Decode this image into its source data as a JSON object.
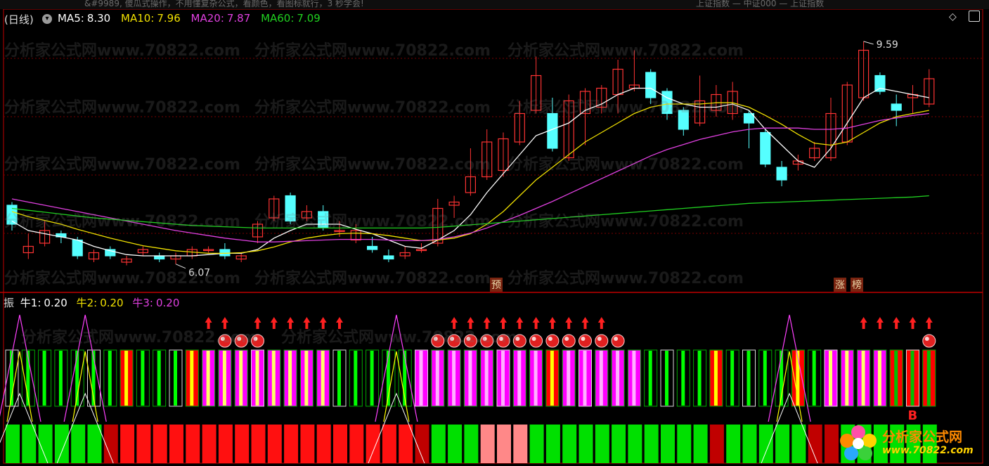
{
  "top_strip": {
    "left_text": "&#9989, 傻瓜式操作，不用懂复杂公式，看颜色，看图标就行，3 秒学会!",
    "right_text": "上证指数 — 中证000 — 上证指数"
  },
  "main_header": {
    "period": "(日线)",
    "ma5_label": "MA5:",
    "ma5_value": "8.30",
    "ma10_label": "MA10:",
    "ma10_value": "7.96",
    "ma20_label": "MA20:",
    "ma20_value": "7.87",
    "ma60_label": "MA60:",
    "ma60_value": "7.09"
  },
  "colors": {
    "ma5": "#ffffff",
    "ma10": "#f0e000",
    "ma20": "#e040e0",
    "ma60": "#20d020",
    "up": "#ff3333",
    "down": "#55ffff",
    "panel_border": "#c00000"
  },
  "price_labels": {
    "high": "9.59",
    "low": "6.07"
  },
  "tags": {
    "yu": "预",
    "zhang": "涨",
    "bang": "榜"
  },
  "watermark": "分析家公式网www.70822.com",
  "sub_header": {
    "title": "振",
    "niu1_label": "牛1:",
    "niu1_value": "0.20",
    "niu2_label": "牛2:",
    "niu2_value": "0.20",
    "niu3_label": "牛3:",
    "niu3_value": "0.20"
  },
  "buy_marker": "B",
  "logo": {
    "name": "分析家公式网",
    "url": "www.70822.com"
  },
  "corner_icons": [
    "diamond-icon",
    "window-restore-icon"
  ],
  "chart_data": {
    "type": "candlestick",
    "title": "",
    "ylim": [
      5.8,
      9.8
    ],
    "candles": [
      [
        7.0,
        6.7,
        7.05,
        6.6
      ],
      [
        6.25,
        6.35,
        6.55,
        6.15
      ],
      [
        6.4,
        6.6,
        6.75,
        6.35
      ],
      [
        6.55,
        6.5,
        6.6,
        6.4
      ],
      [
        6.45,
        6.2,
        6.5,
        6.15
      ],
      [
        6.15,
        6.25,
        6.3,
        6.1
      ],
      [
        6.3,
        6.2,
        6.35,
        6.15
      ],
      [
        6.1,
        6.15,
        6.2,
        6.05
      ],
      [
        6.25,
        6.3,
        6.35,
        6.2
      ],
      [
        6.2,
        6.15,
        6.25,
        6.1
      ],
      [
        6.15,
        6.2,
        6.25,
        6.07
      ],
      [
        6.2,
        6.3,
        6.35,
        6.15
      ],
      [
        6.3,
        6.3,
        6.35,
        6.25
      ],
      [
        6.3,
        6.2,
        6.4,
        6.15
      ],
      [
        6.15,
        6.2,
        6.25,
        6.1
      ],
      [
        6.5,
        6.7,
        6.75,
        6.4
      ],
      [
        6.8,
        7.1,
        7.15,
        6.75
      ],
      [
        7.15,
        6.75,
        7.2,
        6.7
      ],
      [
        6.8,
        6.9,
        7.0,
        6.75
      ],
      [
        6.9,
        6.65,
        7.0,
        6.6
      ],
      [
        6.6,
        6.6,
        6.75,
        6.5
      ],
      [
        6.45,
        6.6,
        6.7,
        6.4
      ],
      [
        6.35,
        6.3,
        6.5,
        6.25
      ],
      [
        6.2,
        6.15,
        6.3,
        6.1
      ],
      [
        6.2,
        6.25,
        6.35,
        6.15
      ],
      [
        6.3,
        6.3,
        6.4,
        6.25
      ],
      [
        6.4,
        6.95,
        7.1,
        6.35
      ],
      [
        7.0,
        7.05,
        7.15,
        6.8
      ],
      [
        7.2,
        7.45,
        7.9,
        7.15
      ],
      [
        7.45,
        8.0,
        8.2,
        7.4
      ],
      [
        7.55,
        8.05,
        8.15,
        7.45
      ],
      [
        8.0,
        8.45,
        8.65,
        7.95
      ],
      [
        8.5,
        9.05,
        9.35,
        8.45
      ],
      [
        8.45,
        7.9,
        8.7,
        7.85
      ],
      [
        7.75,
        8.65,
        8.75,
        7.7
      ],
      [
        8.45,
        8.8,
        8.85,
        7.95
      ],
      [
        8.55,
        8.85,
        8.9,
        8.45
      ],
      [
        8.75,
        9.15,
        9.3,
        8.45
      ],
      [
        8.85,
        8.9,
        9.45,
        8.8
      ],
      [
        9.1,
        8.7,
        9.15,
        8.6
      ],
      [
        8.8,
        8.45,
        8.85,
        8.35
      ],
      [
        8.5,
        8.2,
        8.55,
        8.1
      ],
      [
        8.3,
        8.65,
        9.05,
        8.25
      ],
      [
        8.5,
        8.75,
        8.9,
        8.4
      ],
      [
        8.45,
        8.8,
        8.95,
        8.35
      ],
      [
        8.45,
        8.3,
        8.5,
        7.9
      ],
      [
        8.15,
        7.65,
        8.2,
        7.6
      ],
      [
        7.6,
        7.4,
        7.7,
        7.3
      ],
      [
        7.65,
        7.7,
        7.8,
        7.55
      ],
      [
        7.75,
        7.9,
        8.0,
        7.7
      ],
      [
        7.75,
        8.45,
        8.7,
        7.7
      ],
      [
        8.0,
        8.9,
        8.95,
        7.95
      ],
      [
        8.7,
        9.45,
        9.59,
        8.65
      ],
      [
        9.05,
        8.8,
        9.1,
        8.75
      ],
      [
        8.6,
        8.5,
        8.75,
        8.25
      ],
      [
        8.7,
        8.75,
        8.9,
        8.45
      ],
      [
        8.6,
        9.0,
        9.15,
        8.55
      ]
    ],
    "series": [
      {
        "name": "MA5",
        "values": [
          6.75,
          6.6,
          6.55,
          6.5,
          6.45,
          6.35,
          6.28,
          6.22,
          6.2,
          6.2,
          6.2,
          6.2,
          6.22,
          6.24,
          6.24,
          6.3,
          6.48,
          6.6,
          6.7,
          6.7,
          6.7,
          6.62,
          6.55,
          6.45,
          6.35,
          6.32,
          6.45,
          6.6,
          6.85,
          7.2,
          7.5,
          7.8,
          8.1,
          8.2,
          8.3,
          8.5,
          8.6,
          8.75,
          8.85,
          8.85,
          8.7,
          8.6,
          8.55,
          8.55,
          8.6,
          8.5,
          8.2,
          7.95,
          7.7,
          7.6,
          7.9,
          8.3,
          8.7,
          8.85,
          8.8,
          8.75,
          8.7
        ]
      },
      {
        "name": "MA10",
        "values": [
          6.9,
          6.82,
          6.76,
          6.7,
          6.62,
          6.55,
          6.48,
          6.42,
          6.36,
          6.32,
          6.28,
          6.26,
          6.24,
          6.24,
          6.25,
          6.28,
          6.34,
          6.42,
          6.48,
          6.52,
          6.55,
          6.56,
          6.55,
          6.52,
          6.48,
          6.44,
          6.45,
          6.48,
          6.55,
          6.7,
          6.9,
          7.15,
          7.4,
          7.6,
          7.8,
          8.0,
          8.15,
          8.3,
          8.45,
          8.55,
          8.6,
          8.6,
          8.6,
          8.62,
          8.62,
          8.55,
          8.42,
          8.28,
          8.12,
          7.98,
          7.95,
          8.0,
          8.15,
          8.3,
          8.4,
          8.45,
          8.5
        ]
      },
      {
        "name": "MA20",
        "values": [
          7.1,
          7.05,
          7.0,
          6.95,
          6.9,
          6.85,
          6.8,
          6.75,
          6.7,
          6.65,
          6.6,
          6.56,
          6.52,
          6.48,
          6.45,
          6.42,
          6.42,
          6.43,
          6.44,
          6.45,
          6.46,
          6.46,
          6.46,
          6.45,
          6.44,
          6.44,
          6.46,
          6.5,
          6.56,
          6.64,
          6.74,
          6.84,
          6.95,
          7.06,
          7.18,
          7.3,
          7.42,
          7.54,
          7.66,
          7.78,
          7.88,
          7.96,
          8.04,
          8.1,
          8.16,
          8.2,
          8.22,
          8.22,
          8.22,
          8.2,
          8.2,
          8.22,
          8.28,
          8.34,
          8.38,
          8.42,
          8.45
        ]
      },
      {
        "name": "MA60",
        "values": [
          6.95,
          6.92,
          6.89,
          6.86,
          6.83,
          6.8,
          6.78,
          6.76,
          6.74,
          6.72,
          6.7,
          6.68,
          6.67,
          6.66,
          6.65,
          6.64,
          6.64,
          6.64,
          6.64,
          6.64,
          6.64,
          6.64,
          6.64,
          6.64,
          6.64,
          6.64,
          6.65,
          6.67,
          6.69,
          6.71,
          6.73,
          6.75,
          6.77,
          6.79,
          6.81,
          6.83,
          6.85,
          6.87,
          6.89,
          6.91,
          6.93,
          6.95,
          6.97,
          6.99,
          7.01,
          7.03,
          7.04,
          7.05,
          7.06,
          7.07,
          7.08,
          7.09,
          7.1,
          7.11,
          7.12,
          7.13,
          7.15
        ]
      }
    ]
  }
}
